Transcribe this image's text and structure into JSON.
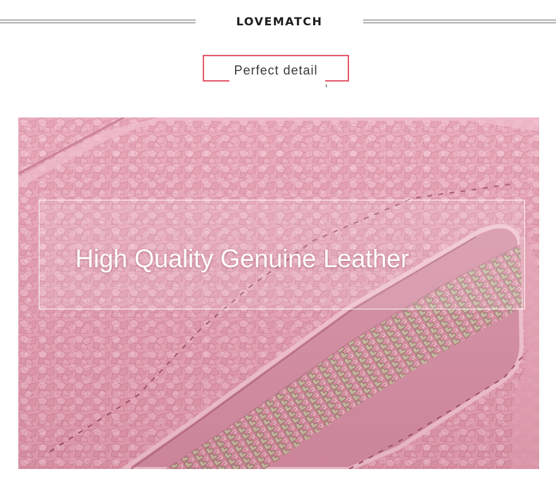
{
  "header": {
    "brand": "LOVEMATCH",
    "section_title": "Perfect detail"
  },
  "photo": {
    "caption": "High Quality Genuine Leather",
    "subject": "pink pebbled genuine leather wallet with metal zipper",
    "colors": {
      "leather": "#e69fb2",
      "leather_dark": "#c97a91",
      "leather_light": "#f3c2cf",
      "stitch": "#9e4d63",
      "zipper_tape": "#d98fa4",
      "zipper_teeth": "#c8b89a",
      "frame_accent": "#e45a6c"
    }
  }
}
